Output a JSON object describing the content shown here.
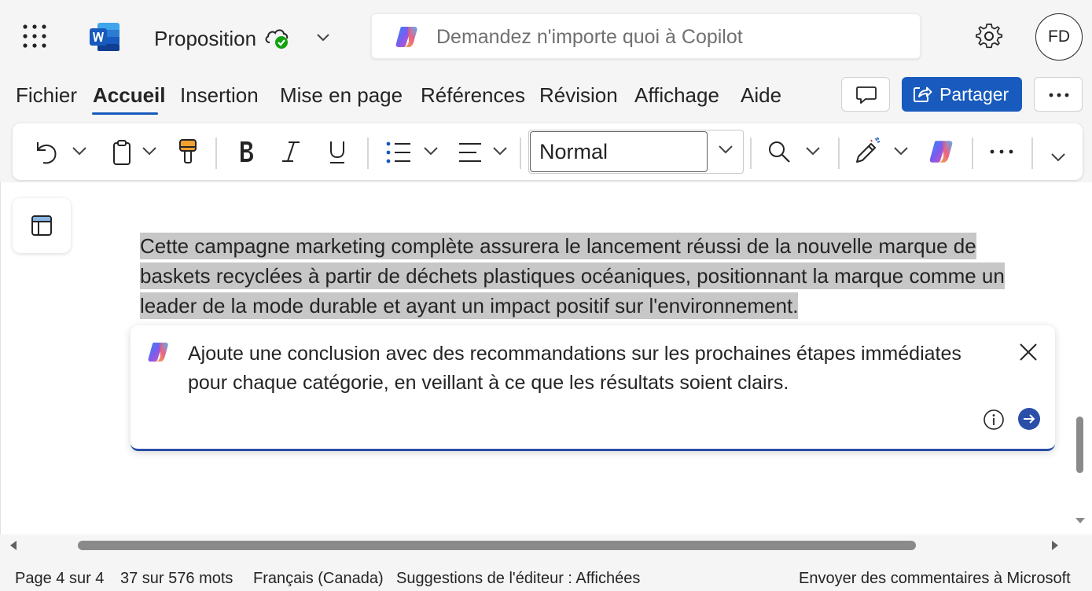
{
  "app": {
    "name": "Word",
    "document_title": "Proposition",
    "save_status_icon": "cloud-saved-icon"
  },
  "search": {
    "placeholder": "Demandez n'importe quoi à Copilot"
  },
  "user": {
    "initials": "FD"
  },
  "menu": {
    "tabs": [
      {
        "label": "Fichier",
        "active": false
      },
      {
        "label": "Accueil",
        "active": true
      },
      {
        "label": "Insertion",
        "active": false
      },
      {
        "label": "Mise en page",
        "active": false
      },
      {
        "label": "Références",
        "active": false
      },
      {
        "label": "Révision",
        "active": false
      },
      {
        "label": "Affichage",
        "active": false
      },
      {
        "label": "Aide",
        "active": false
      }
    ],
    "share_label": "Partager"
  },
  "ribbon": {
    "style_value": "Normal",
    "buttons": [
      "undo-icon",
      "clipboard-icon",
      "format-painter-icon",
      "bold-icon",
      "italic-icon",
      "underline-icon",
      "bullets-icon",
      "align-icon",
      "find-icon",
      "editor-icon",
      "copilot-icon",
      "more-icon"
    ]
  },
  "document": {
    "highlighted_text": "Cette campagne marketing complète assurera le lancement réussi de la nouvelle marque de baskets recyclées à partir de déchets plastiques océaniques, positionnant la marque comme un leader de la mode durable et ayant un impact positif sur l'environnement."
  },
  "copilot_prompt": {
    "text": "Ajoute une conclusion avec des recommandations sur les prochaines étapes immédiates pour chaque catégorie, en veillant à ce que les résultats soient clairs."
  },
  "status": {
    "page": "Page 4 sur 4",
    "words": "37 sur 576 mots",
    "language": "Français (Canada)",
    "editor_suggestions": "Suggestions de l'éditeur : Affichées",
    "feedback": "Envoyer des commentaires à Microsoft"
  },
  "colors": {
    "accent": "#185abd",
    "highlight": "#c7c7c7",
    "chrome_bg": "#f5f5f5"
  }
}
